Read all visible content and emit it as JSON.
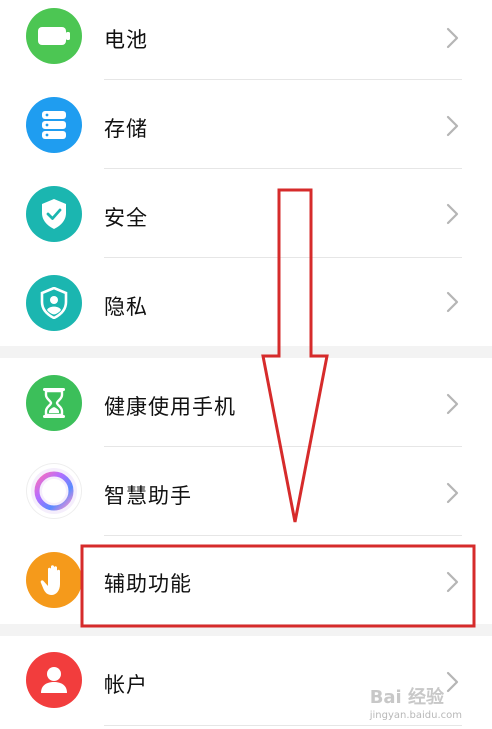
{
  "settings": {
    "items": [
      {
        "label": "电池",
        "icon": "battery-icon",
        "color": "#4cc653"
      },
      {
        "label": "存储",
        "icon": "storage-icon",
        "color": "#1f9df0"
      },
      {
        "label": "安全",
        "icon": "shield-check-icon",
        "color": "#1bb6b0"
      },
      {
        "label": "隐私",
        "icon": "privacy-icon",
        "color": "#1bb6b0"
      },
      {
        "label": "健康使用手机",
        "icon": "hourglass-icon",
        "color": "#3cbf5a"
      },
      {
        "label": "智慧助手",
        "icon": "assistant-ring-icon",
        "color": "#ffffff"
      },
      {
        "label": "辅助功能",
        "icon": "hand-icon",
        "color": "#f59a1b"
      },
      {
        "label": "帐户",
        "icon": "account-icon",
        "color": "#f23d3d"
      }
    ]
  },
  "annotation": {
    "arrow_color": "#d62b2b",
    "highlight_color": "#d62b2b"
  },
  "watermark": {
    "brand": "Bai 经验",
    "site": "jingyan.baidu.com"
  }
}
